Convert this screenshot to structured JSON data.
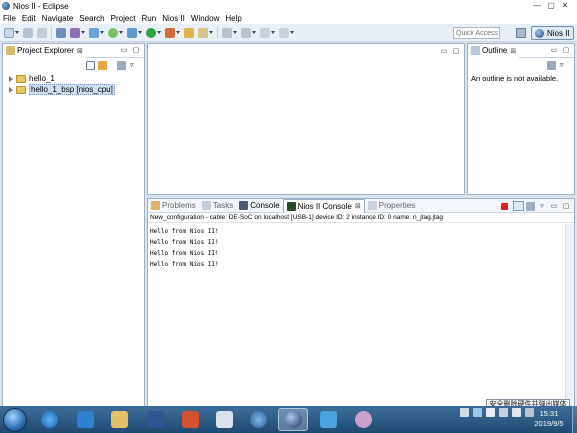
{
  "window": {
    "title": "Nios II - Eclipse"
  },
  "menu": [
    "File",
    "Edit",
    "Navigate",
    "Search",
    "Project",
    "Run",
    "Nios II",
    "Window",
    "Help"
  ],
  "toolbar": {
    "quick_access_placeholder": "Quick Access",
    "perspective_label": "Nios II"
  },
  "project_explorer": {
    "tab_label": "Project Explorer",
    "tab_close": "⊠",
    "items": [
      {
        "label": "hello_1"
      },
      {
        "label": "hello_1_bsp [nios_cpu]"
      }
    ]
  },
  "outline": {
    "tab_label": "Outline",
    "tab_close": "⊠",
    "message": "An outline is not available."
  },
  "bottom_panel": {
    "tabs": [
      {
        "label": "Problems"
      },
      {
        "label": "Tasks"
      },
      {
        "label": "Console"
      },
      {
        "label": "Nios II Console",
        "close": "⊠"
      },
      {
        "label": "Properties"
      }
    ],
    "console_header": "New_configuration - cable: DE-SoC on localhost [USB-1] device ID: 2 instance ID: 0 name: n_jtag.jtag",
    "lines": [
      "Hello from Nios II!",
      "Hello from Nios II!",
      "Hello from Nios II!",
      "Hello from Nios II!"
    ]
  },
  "taskbar": {
    "tooltip": "安全删除硬件并弹出媒体",
    "time": "15:31",
    "date": "2019/9/5"
  },
  "colors": {
    "accent": "#2a6db0",
    "selection": "#cfe0f5",
    "taskbar": "#1f4a72"
  }
}
